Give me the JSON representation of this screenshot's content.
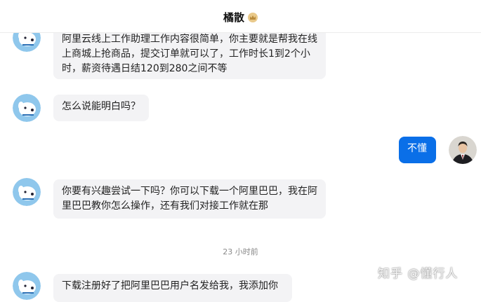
{
  "header": {
    "title": "橘散",
    "badge_icon": "crown-badge-icon"
  },
  "colors": {
    "accent": "#0a6fe8",
    "incoming_bubble": "#f3f3f5",
    "avatar_bg": "#8fc7ec"
  },
  "messages": [
    {
      "side": "in",
      "text": "阿里云线上工作助理工作内容很简单，你主要就是帮我在线上商城上抢商品，提交订单就可以了，工作时长1到2个小时，薪资待遇日结120到280之间不等"
    },
    {
      "side": "in",
      "text": "怎么说能明白吗？"
    },
    {
      "side": "out",
      "text": "不懂"
    },
    {
      "side": "in",
      "text": "你要有兴趣尝试一下吗？你可以下载一个阿里巴巴，我在阿里巴巴教你怎么操作，还有我们对接工作就在那"
    },
    {
      "side": "in",
      "text": "下载注册好了把阿里巴巴用户名发给我，我添加你"
    }
  ],
  "timestamp": "23 小时前",
  "watermark": "知乎 @懂行人"
}
